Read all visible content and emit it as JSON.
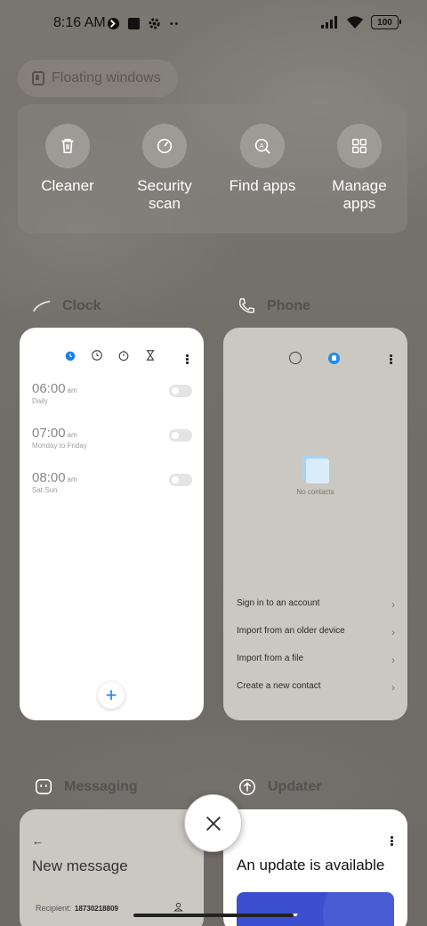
{
  "status_bar": {
    "time": "8:16 AM",
    "battery": "100"
  },
  "floating_windows": {
    "label": "Floating windows"
  },
  "tools": [
    {
      "label": "Cleaner"
    },
    {
      "label": "Security scan"
    },
    {
      "label": "Find apps"
    },
    {
      "label": "Manage apps"
    }
  ],
  "apps": {
    "clock": {
      "name": "Clock",
      "alarms": [
        {
          "time": "06:00",
          "suffix": "am",
          "repeat": "Daily"
        },
        {
          "time": "07:00",
          "suffix": "am",
          "repeat": "Monday to Friday"
        },
        {
          "time": "08:00",
          "suffix": "am",
          "repeat": "Sat Sun"
        }
      ],
      "add_label": "+"
    },
    "phone": {
      "name": "Phone",
      "empty_text": "No contacts",
      "options": [
        "Sign in to an account",
        "Import from an older device",
        "Import from a file",
        "Create a new contact"
      ]
    },
    "messaging": {
      "name": "Messaging",
      "title": "New message",
      "recipient_label": "Recipient:",
      "recipient_value": "18730218809"
    },
    "updater": {
      "name": "Updater",
      "title": "An update is available"
    }
  },
  "colors": {
    "accent": "#1a7ff0",
    "update_banner": "#3b4fd0"
  }
}
